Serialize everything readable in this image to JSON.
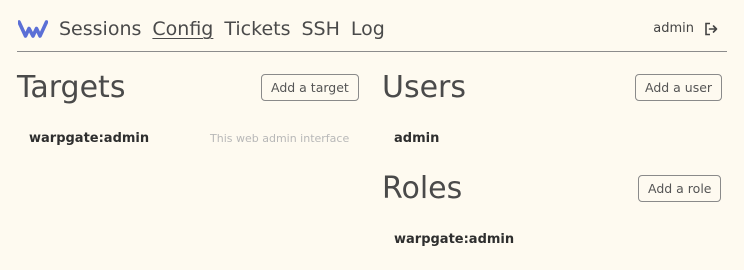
{
  "header": {
    "logo_icon": "warpgate-logo-icon",
    "nav": [
      {
        "label": "Sessions",
        "active": false
      },
      {
        "label": "Config",
        "active": true
      },
      {
        "label": "Tickets",
        "active": false
      },
      {
        "label": "SSH",
        "active": false
      },
      {
        "label": "Log",
        "active": false
      }
    ],
    "username": "admin",
    "logout_icon": "logout-icon"
  },
  "targets": {
    "title": "Targets",
    "add_label": "Add a target",
    "items": [
      {
        "name": "warpgate:admin",
        "description": "This web admin interface"
      }
    ]
  },
  "users": {
    "title": "Users",
    "add_label": "Add a user",
    "items": [
      {
        "name": "admin"
      }
    ]
  },
  "roles": {
    "title": "Roles",
    "add_label": "Add a role",
    "items": [
      {
        "name": "warpgate:admin"
      }
    ]
  },
  "colors": {
    "background": "#fefaf0",
    "accent": "#5b6fd6",
    "text": "#3f3f3f"
  }
}
